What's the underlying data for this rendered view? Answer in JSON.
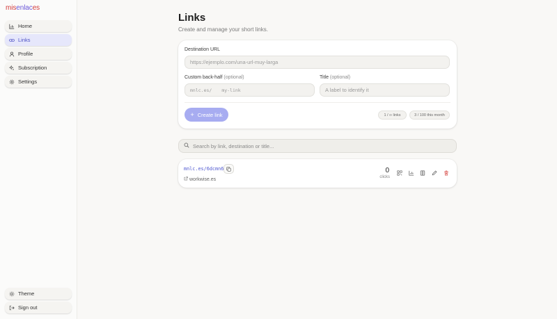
{
  "brand": {
    "part1": "mis",
    "part2": "enlac",
    "part3": "es",
    "color_red": "#d23a3a",
    "color_purple": "#6b57d9"
  },
  "sidebar": {
    "items": [
      {
        "label": "Home",
        "icon": "chart-icon"
      },
      {
        "label": "Links",
        "icon": "link-icon",
        "active": true
      },
      {
        "label": "Profile",
        "icon": "user-icon"
      },
      {
        "label": "Subscription",
        "icon": "sparkle-icon"
      },
      {
        "label": "Settings",
        "icon": "gear-icon"
      }
    ],
    "bottom": [
      {
        "label": "Theme",
        "icon": "sun-icon"
      },
      {
        "label": "Sign out",
        "icon": "sign-out-icon"
      }
    ]
  },
  "page": {
    "title": "Links",
    "subtitle": "Create and manage your short links."
  },
  "create_form": {
    "destination_label": "Destination URL",
    "destination_placeholder": "https://ejemplo.com/una-url-muy-larga",
    "backhalf_label": "Custom back-half",
    "backhalf_optional": "(optional)",
    "backhalf_prefix": "mnlc.es/",
    "backhalf_placeholder": "my-link",
    "title_label": "Title",
    "title_optional": "(optional)",
    "title_placeholder": "A label to identify it",
    "create_button": "Create link",
    "links_pill": "1 / ∞ links",
    "month_pill": "3 / 100 this month",
    "accent": "#a7acf1"
  },
  "search": {
    "placeholder": "Search by link, destination or title..."
  },
  "links": [
    {
      "short_url": "mnlc.es/6dcmn6",
      "destination": "workwise.es",
      "clicks": "0",
      "clicks_label": "clicks"
    }
  ]
}
